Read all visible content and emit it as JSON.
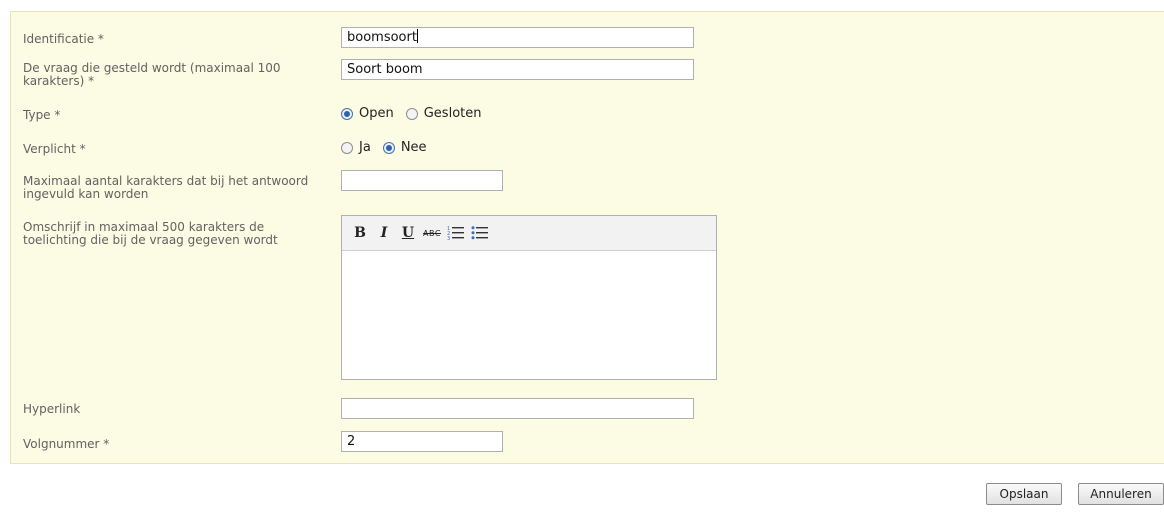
{
  "form": {
    "identificatie": {
      "label": "Identificatie *",
      "value": "boomsoort"
    },
    "vraag": {
      "label": "De vraag die gesteld wordt (maximaal 100 karakters) *",
      "value": "Soort boom"
    },
    "type": {
      "label": "Type *",
      "options": [
        "Open",
        "Gesloten"
      ],
      "selected": "Open"
    },
    "verplicht": {
      "label": "Verplicht *",
      "options": [
        "Ja",
        "Nee"
      ],
      "selected": "Nee"
    },
    "maxkarakters": {
      "label": "Maximaal aantal karakters dat bij het antwoord ingevuld kan worden",
      "value": ""
    },
    "toelichting": {
      "label": "Omschrijf in maximaal 500 karakters de toelichting die bij de vraag gegeven wordt",
      "value": "",
      "toolbar": {
        "bold": "B",
        "italic": "I",
        "underline": "U",
        "strikethrough": "ABC",
        "ordered_list_icon": "ordered-list-icon",
        "unordered_list_icon": "unordered-list-icon"
      }
    },
    "hyperlink": {
      "label": "Hyperlink",
      "value": ""
    },
    "volgnummer": {
      "label": "Volgnummer *",
      "value": "2"
    }
  },
  "buttons": {
    "save": "Opslaan",
    "cancel": "Annuleren"
  }
}
